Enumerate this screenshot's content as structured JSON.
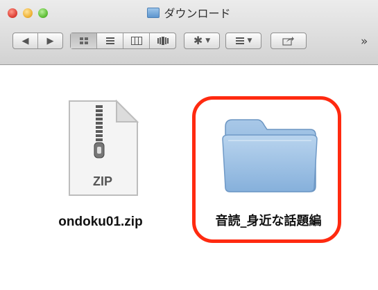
{
  "window": {
    "title": "ダウンロード"
  },
  "toolbar": {
    "back_glyph": "◀",
    "forward_glyph": "▶",
    "view_icons": "icon-view-icon",
    "view_list": "list-view-icon",
    "view_columns": "column-view-icon",
    "view_coverflow": "coverflow-view-icon",
    "gear_icon": "gear-icon",
    "arrange_icon": "arrange-icon",
    "share_icon": "share-icon",
    "overflow": "»"
  },
  "files": [
    {
      "name": "ondoku01.zip",
      "icon": "zip-archive-icon",
      "badge": "ZIP"
    },
    {
      "name": "音読_身近な話題編",
      "icon": "folder-icon"
    }
  ],
  "colors": {
    "highlight": "#ff2a10",
    "folder": "#8fb5dc"
  }
}
